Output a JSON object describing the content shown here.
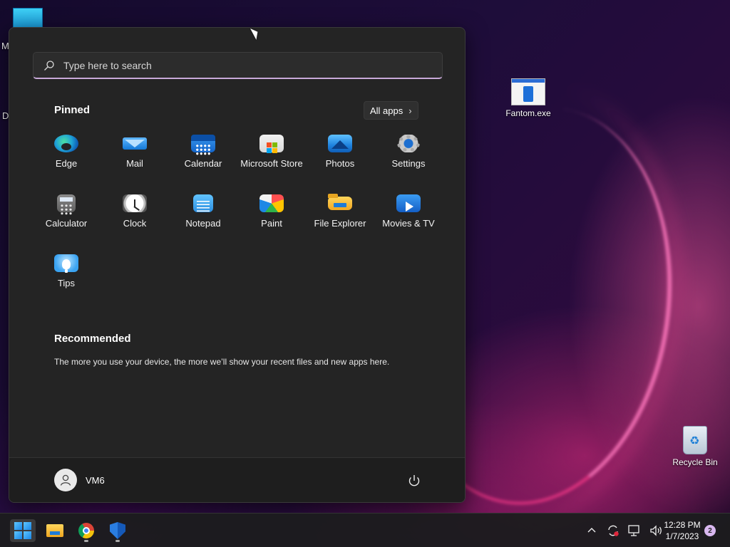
{
  "desktop": {
    "icons": [
      {
        "label": "Fantom.exe"
      },
      {
        "label": "Recycle Bin"
      }
    ],
    "clipped_labels": [
      "M",
      "Da"
    ]
  },
  "start_menu": {
    "search": {
      "placeholder": "Type here to search",
      "value": ""
    },
    "pinned": {
      "title": "Pinned",
      "all_apps_label": "All apps",
      "apps": [
        {
          "label": "Edge",
          "icon": "edge-icon"
        },
        {
          "label": "Mail",
          "icon": "mail-icon"
        },
        {
          "label": "Calendar",
          "icon": "calendar-icon"
        },
        {
          "label": "Microsoft Store",
          "icon": "store-icon"
        },
        {
          "label": "Photos",
          "icon": "photos-icon"
        },
        {
          "label": "Settings",
          "icon": "gear-icon"
        },
        {
          "label": "Calculator",
          "icon": "calculator-icon"
        },
        {
          "label": "Clock",
          "icon": "clock-icon"
        },
        {
          "label": "Notepad",
          "icon": "notepad-icon"
        },
        {
          "label": "Paint",
          "icon": "paint-icon"
        },
        {
          "label": "File Explorer",
          "icon": "folder-icon"
        },
        {
          "label": "Movies & TV",
          "icon": "movies-icon"
        },
        {
          "label": "Tips",
          "icon": "lightbulb-icon"
        }
      ]
    },
    "recommended": {
      "title": "Recommended",
      "empty_text": "The more you use your device, the more we’ll show your recent files and new apps here."
    },
    "footer": {
      "user_name": "VM6"
    }
  },
  "taskbar": {
    "pinned": [
      "windows-start",
      "file-explorer",
      "chrome",
      "windows-security"
    ],
    "clock": {
      "time": "12:28 PM",
      "date": "1/7/2023"
    },
    "notification_count": "2"
  },
  "colors": {
    "menu_bg": "#242424",
    "accent": "#c9a9d9",
    "taskbar_bg": "#1c1c1e"
  }
}
